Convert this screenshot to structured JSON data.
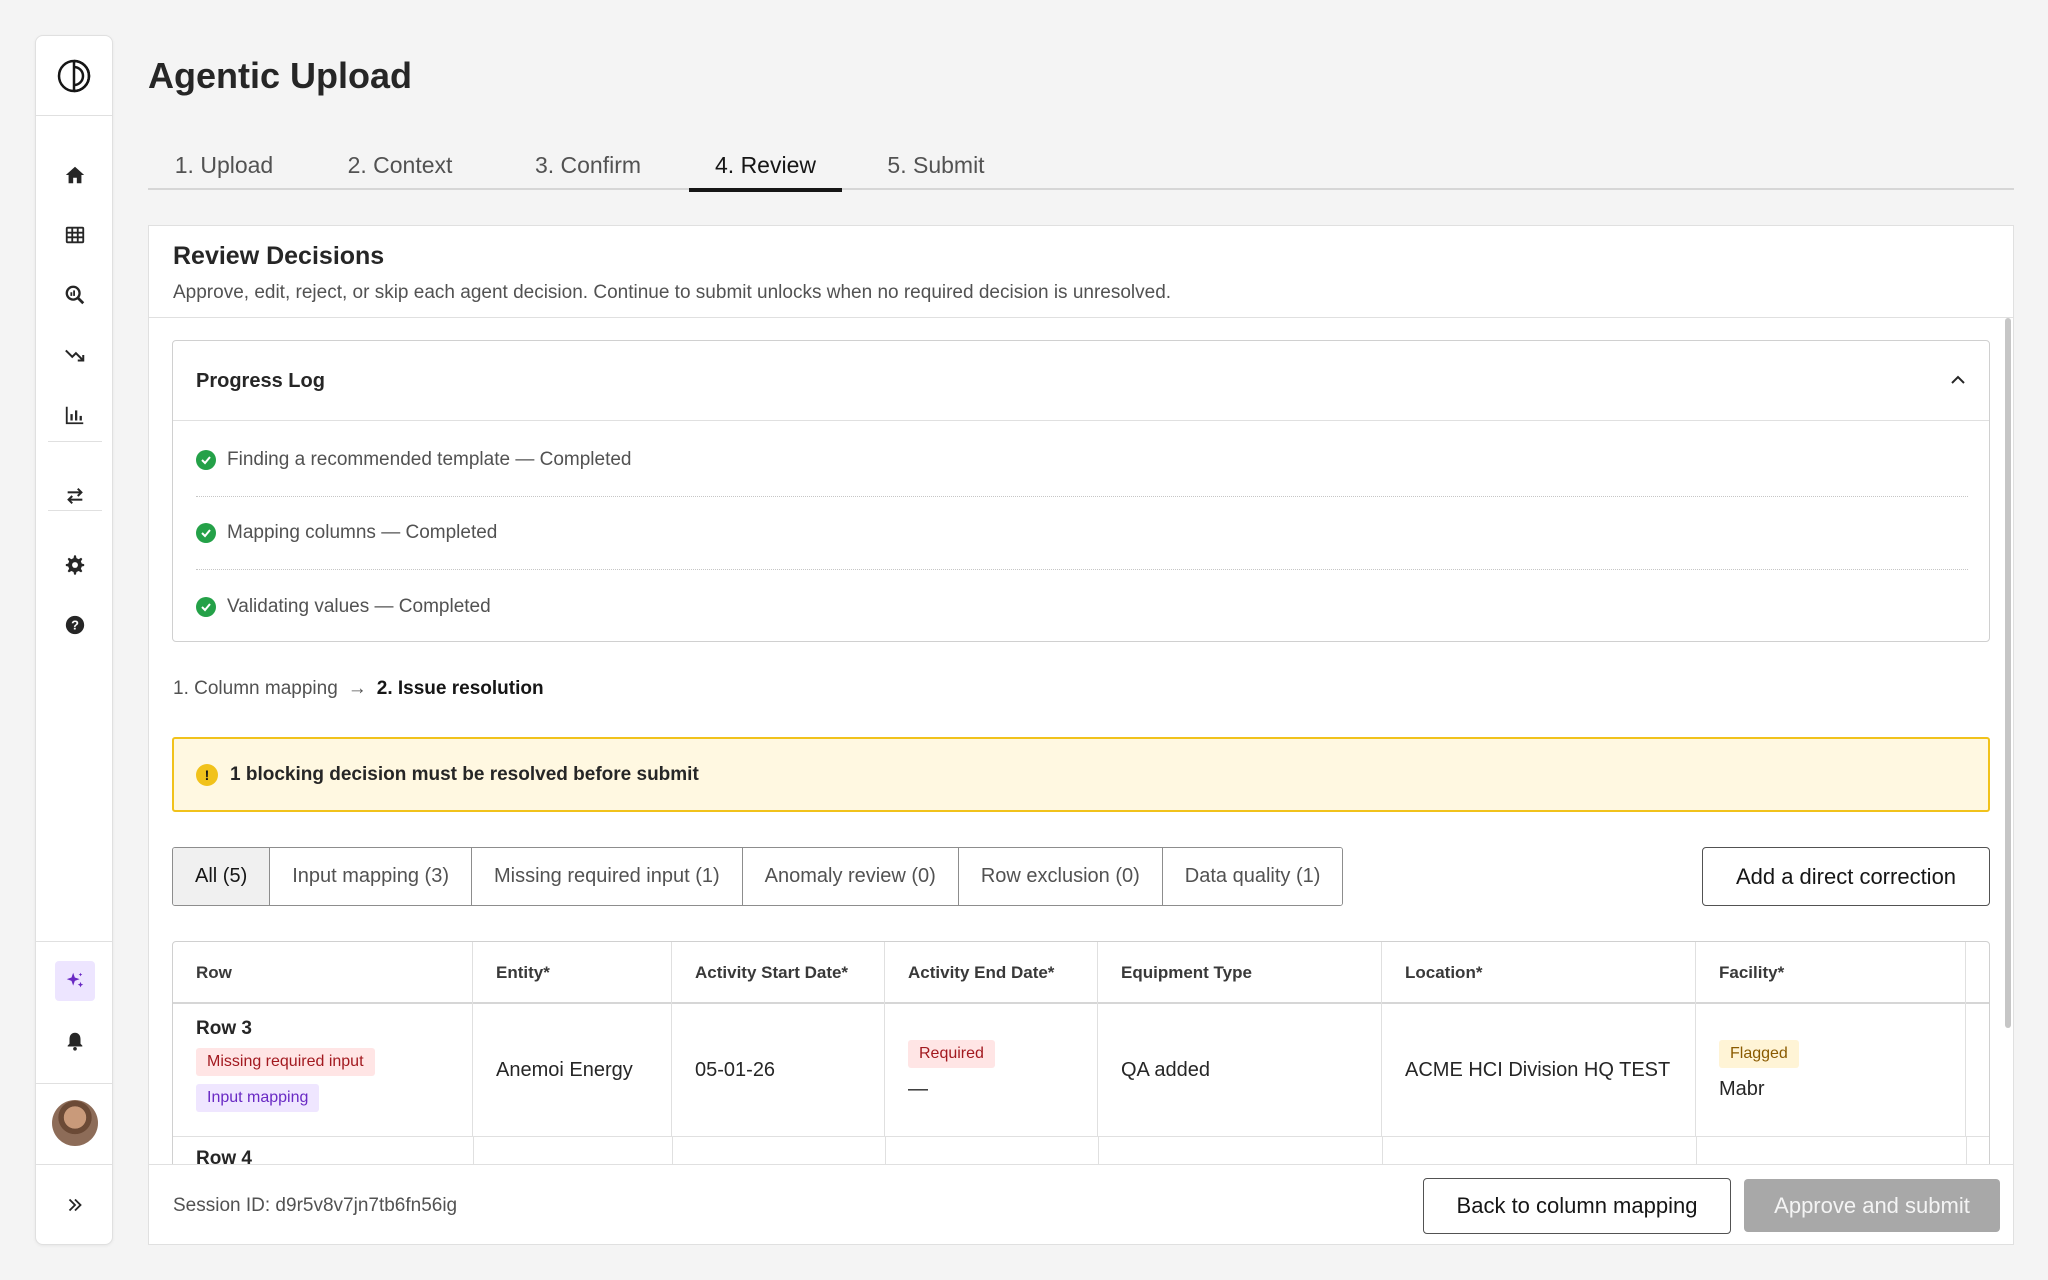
{
  "app": {
    "title": "Agentic Upload"
  },
  "sidebar": {
    "icons": [
      "logo-icon",
      "home-icon",
      "table-icon",
      "search-analytics-icon",
      "trend-down-icon",
      "bar-chart-icon",
      "transfer-icon",
      "gear-icon",
      "help-icon",
      "sparkle-icon",
      "bell-icon",
      "avatar",
      "expand-icon"
    ]
  },
  "tabs": [
    {
      "label": "1.  Upload"
    },
    {
      "label": "2.  Context"
    },
    {
      "label": "3.  Confirm"
    },
    {
      "label": "4.  Review",
      "active": true
    },
    {
      "label": "5.  Submit"
    }
  ],
  "review": {
    "title": "Review Decisions",
    "subtitle": "Approve, edit, reject, or skip each agent decision. Continue to submit unlocks when no required decision is unresolved."
  },
  "progress_log": {
    "title": "Progress Log",
    "items": [
      "Finding a recommended template — Completed",
      "Mapping columns — Completed",
      "Validating values — Completed"
    ]
  },
  "breadcrumb": {
    "step1": "1. Column mapping",
    "arrow": "→",
    "step2": "2. Issue resolution"
  },
  "warning": {
    "icon": "!",
    "text": "1 blocking decision must be resolved before submit"
  },
  "filters": [
    "All (5)",
    "Input mapping (3)",
    "Missing required input (1)",
    "Anomaly review (0)",
    "Row exclusion (0)",
    "Data quality (1)"
  ],
  "add_correction_label": "Add a direct correction",
  "table": {
    "headers": [
      "Row",
      "Entity*",
      "Activity Start Date*",
      "Activity End Date*",
      "Equipment Type",
      "Location*",
      "Facility*"
    ],
    "rows": [
      {
        "row": "Row 3",
        "tags": [
          "Missing required input",
          "Input mapping"
        ],
        "entity": "Anemoi Energy",
        "start_date": "05-01-26",
        "end_date_tag": "Required",
        "end_date": "—",
        "equipment": "QA added",
        "location": "ACME HCI Division HQ TEST",
        "facility_tag": "Flagged",
        "facility": "Mabr"
      },
      {
        "row": "Row 4"
      }
    ]
  },
  "footer": {
    "session": "Session ID: d9r5v8v7jn7tb6fn56ig",
    "back_label": "Back to column mapping",
    "approve_label": "Approve and submit"
  }
}
